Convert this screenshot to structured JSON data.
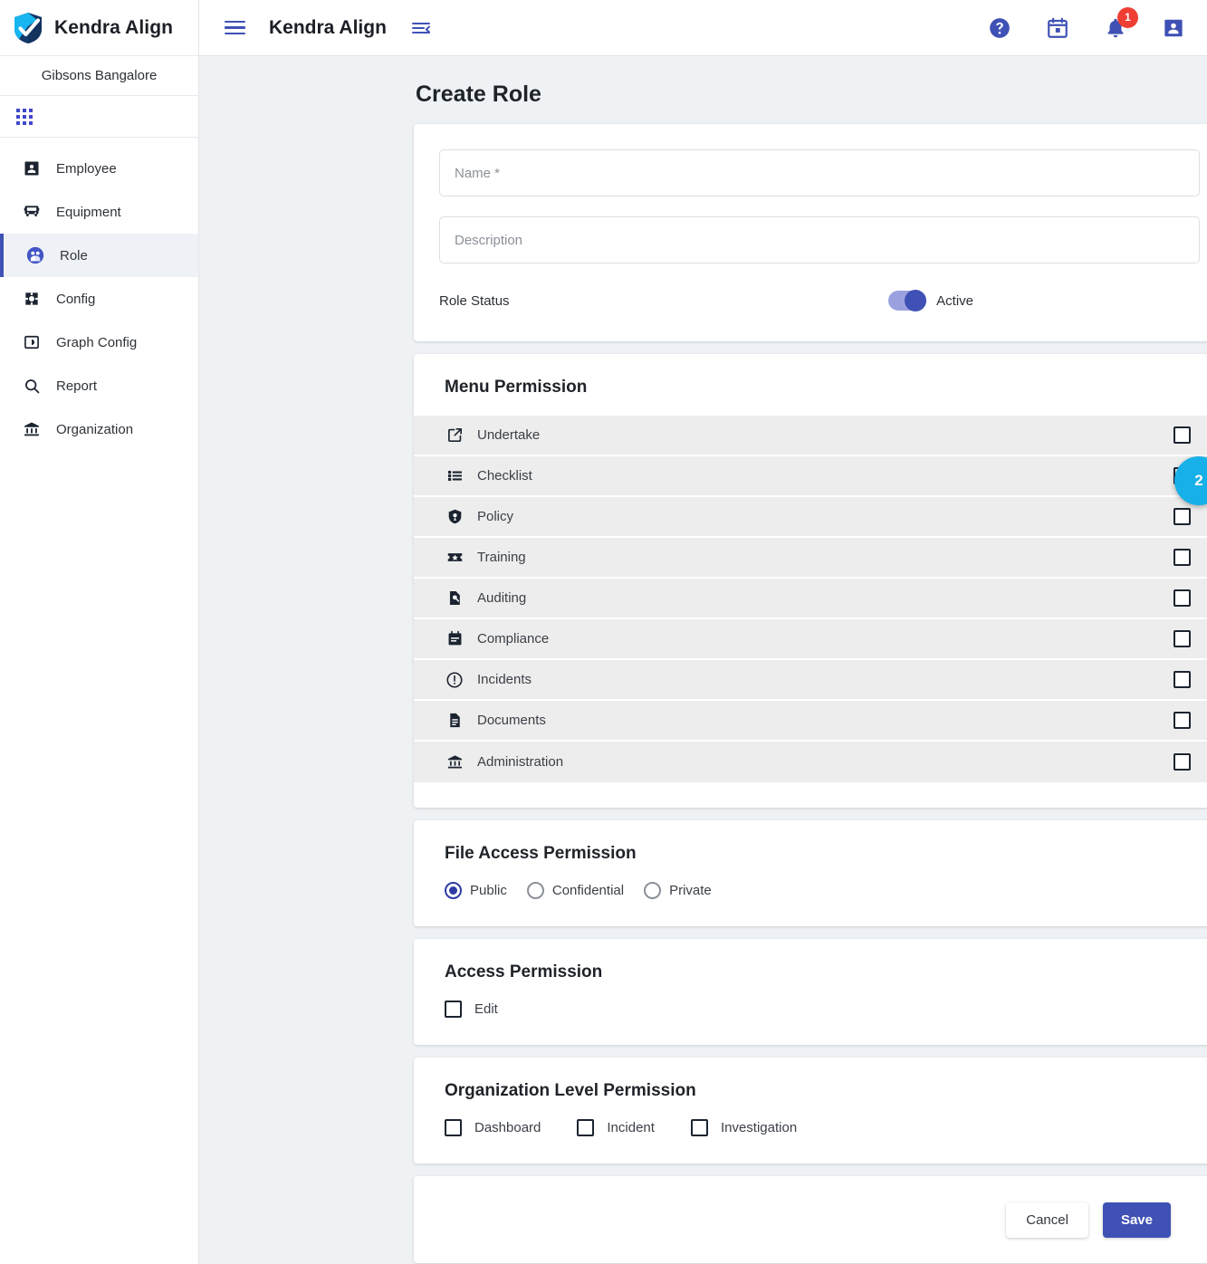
{
  "sidebar": {
    "brand_name": "Kendra Align",
    "organization": "Gibsons Bangalore",
    "apps_icon": "grid-apps-icon",
    "items": [
      {
        "label": "Employee",
        "icon": "person-badge-icon",
        "active": false
      },
      {
        "label": "Equipment",
        "icon": "bus-icon",
        "active": false
      },
      {
        "label": "Role",
        "icon": "group-people-icon",
        "active": true
      },
      {
        "label": "Config",
        "icon": "gear-icon",
        "active": false
      },
      {
        "label": "Graph Config",
        "icon": "contrast-box-icon",
        "active": false
      },
      {
        "label": "Report",
        "icon": "search-icon",
        "active": false
      },
      {
        "label": "Organization",
        "icon": "bank-icon",
        "active": false
      }
    ]
  },
  "topbar": {
    "menu_icon": "hamburger-menu-icon",
    "title": "Kendra Align",
    "collapse_icon": "menu-collapse-icon",
    "help_icon": "help-circle-icon",
    "calendar_icon": "calendar-icon",
    "notifications_icon": "bell-icon",
    "notifications_count": "1",
    "account_icon": "person-badge-icon"
  },
  "page": {
    "title": "Create Role"
  },
  "form": {
    "name_placeholder": "Name *",
    "name_value": "",
    "description_placeholder": "Description",
    "description_value": "",
    "status_label": "Role Status",
    "status_toggle_state": "on",
    "status_text": "Active"
  },
  "menu_permission": {
    "title": "Menu Permission",
    "rows": [
      {
        "label": "Undertake",
        "icon": "external-link-icon",
        "checked": false
      },
      {
        "label": "Checklist",
        "icon": "list-icon",
        "checked": false
      },
      {
        "label": "Policy",
        "icon": "shield-policy-icon",
        "checked": false
      },
      {
        "label": "Training",
        "icon": "ticket-star-icon",
        "checked": false
      },
      {
        "label": "Auditing",
        "icon": "document-search-icon",
        "checked": false
      },
      {
        "label": "Compliance",
        "icon": "calendar-note-icon",
        "checked": false
      },
      {
        "label": "Incidents",
        "icon": "alert-circle-icon",
        "checked": false
      },
      {
        "label": "Documents",
        "icon": "document-icon",
        "checked": false
      },
      {
        "label": "Administration",
        "icon": "bank-icon",
        "checked": false
      }
    ]
  },
  "file_access_permission": {
    "title": "File Access Permission",
    "selected": "Public",
    "options": [
      {
        "label": "Public",
        "selected": true
      },
      {
        "label": "Confidential",
        "selected": false
      },
      {
        "label": "Private",
        "selected": false
      }
    ]
  },
  "access_permission": {
    "title": "Access Permission",
    "options": [
      {
        "label": "Edit",
        "checked": false
      }
    ]
  },
  "organization_level_permission": {
    "title": "Organization Level Permission",
    "options": [
      {
        "label": "Dashboard",
        "checked": false
      },
      {
        "label": "Incident",
        "checked": false
      },
      {
        "label": "Investigation",
        "checked": false
      }
    ]
  },
  "footer": {
    "cancel_label": "Cancel",
    "save_label": "Save"
  },
  "floating_action": {
    "label": "2",
    "icon": "chat-bubble-badge-icon"
  },
  "colors": {
    "accent_indigo": "#3f51b5",
    "badge_red": "#ef3e33",
    "fab_cyan": "#18b0e8",
    "page_bg": "#eef2f5",
    "row_bg": "#ededed"
  }
}
